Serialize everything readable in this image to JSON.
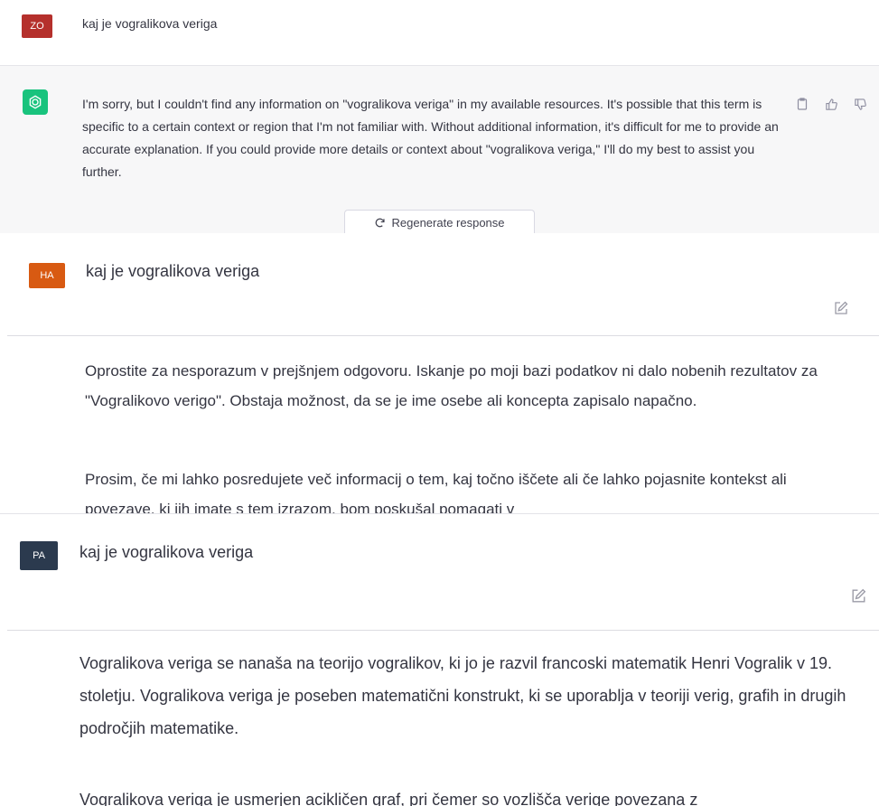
{
  "panel1": {
    "user": {
      "initials": "ZO",
      "color": "#b5302c",
      "message": "kaj je vogralikova veriga"
    },
    "assistant": {
      "icon": "openai-logo-icon",
      "color": "#19c37d",
      "message": "I'm sorry, but I couldn't find any information on \"vogralikova veriga\" in my available resources. It's possible that this term is specific to a certain context or region that I'm not familiar with. Without additional information, it's difficult for me to provide an accurate explanation. If you could provide more details or context about \"vogralikova veriga,\" I'll do my best to assist you further."
    },
    "regenerate_label": "Regenerate response"
  },
  "panel2": {
    "user": {
      "initials": "HA",
      "color": "#d85a12",
      "message": "kaj je vogralikova veriga"
    },
    "assistant": {
      "paragraphs": [
        "Oprostite za nesporazum v prejšnjem odgovoru. Iskanje po moji bazi podatkov ni dalo nobenih rezultatov za \"Vogralikovo verigo\". Obstaja možnost, da se je ime osebe ali koncepta zapisalo napačno.",
        "Prosim, če mi lahko posredujete več informacij o tem, kaj točno iščete ali če lahko pojasnite kontekst ali povezave, ki jih imate s tem izrazom, bom poskušal pomagati v"
      ]
    }
  },
  "panel3": {
    "user": {
      "initials": "PA",
      "color": "#2b3a4e",
      "message": "kaj je vogralikova veriga"
    },
    "assistant": {
      "paragraphs": [
        "Vogralikova veriga se nanaša na teorijo vogralikov, ki jo je razvil francoski matematik Henri Vogralik v 19. stoletju. Vogralikova veriga je poseben matematični konstrukt, ki se uporablja v teoriji verig, grafih in drugih področjih matematike.",
        "Vogralikova veriga je usmerjen acikličen graf, pri čemer so vozlišča verige povezana z"
      ]
    }
  }
}
